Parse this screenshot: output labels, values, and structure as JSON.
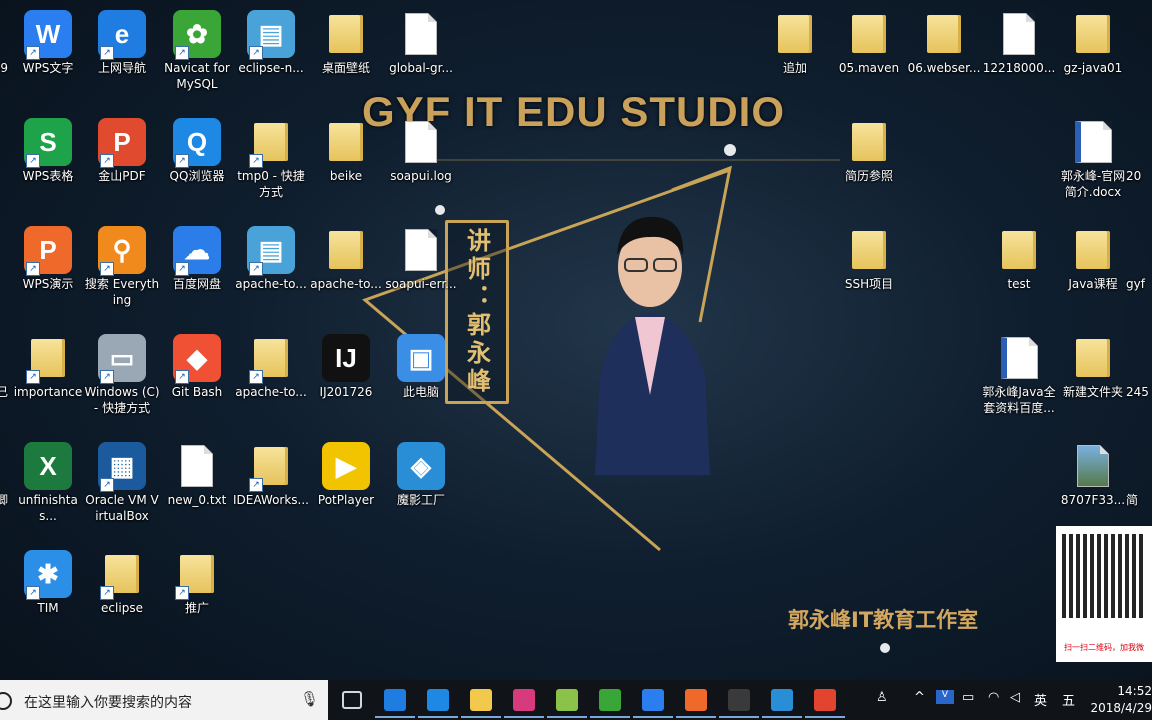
{
  "wallpaper": {
    "title": "GYF IT EDU STUDIO",
    "teacher_label": "讲师：郭永峰",
    "studio_name": "郭永峰IT教育工作室"
  },
  "left_edge_fragments": [
    "9",
    "己",
    "卿"
  ],
  "icons_left": [
    {
      "label": "WPS文字",
      "icon": "wps-writer-icon",
      "color": "#2a7ef0",
      "glyph": "W"
    },
    {
      "label": "上网导航",
      "icon": "ie-browser-icon",
      "color": "#1f7ce0",
      "glyph": "e"
    },
    {
      "label": "Navicat for MySQL",
      "icon": "navicat-icon",
      "color": "#3aa637",
      "glyph": "✿"
    },
    {
      "label": "eclipse-n...",
      "icon": "zip-archive-icon",
      "color": "#4aa3d8",
      "glyph": "▤"
    },
    {
      "label": "桌面壁纸",
      "icon": "folder-icon",
      "color": "",
      "glyph": ""
    },
    {
      "label": "global-gr...",
      "icon": "document-icon",
      "color": "",
      "glyph": ""
    },
    {
      "label": "WPS表格",
      "icon": "wps-spreadsheet-icon",
      "color": "#1fa34a",
      "glyph": "S"
    },
    {
      "label": "金山PDF",
      "icon": "pdf-icon",
      "color": "#e04a2f",
      "glyph": "P"
    },
    {
      "label": "QQ浏览器",
      "icon": "qq-browser-icon",
      "color": "#1e88e5",
      "glyph": "Q"
    },
    {
      "label": "tmp0 - 快捷方式",
      "icon": "folder-icon",
      "color": "",
      "glyph": ""
    },
    {
      "label": "beike",
      "icon": "folder-icon",
      "color": "",
      "glyph": ""
    },
    {
      "label": "soapui.log",
      "icon": "document-icon",
      "color": "",
      "glyph": ""
    },
    {
      "label": "WPS演示",
      "icon": "wps-presentation-icon",
      "color": "#ef6a2a",
      "glyph": "P"
    },
    {
      "label": "搜索 Everything",
      "icon": "everything-search-icon",
      "color": "#f08a1c",
      "glyph": "⚲"
    },
    {
      "label": "百度网盘",
      "icon": "baidu-netdisk-icon",
      "color": "#2b7de9",
      "glyph": "☁"
    },
    {
      "label": "apache-to...",
      "icon": "zip-archive-icon",
      "color": "#4aa3d8",
      "glyph": "▤"
    },
    {
      "label": "apache-to...",
      "icon": "folder-icon",
      "color": "",
      "glyph": ""
    },
    {
      "label": "soapui-err...",
      "icon": "document-icon",
      "color": "",
      "glyph": ""
    },
    {
      "label": "importance",
      "icon": "folder-icon",
      "color": "",
      "glyph": ""
    },
    {
      "label": "Windows (C) - 快捷方式",
      "icon": "drive-icon",
      "color": "#9aa7b4",
      "glyph": "▭"
    },
    {
      "label": "Git Bash",
      "icon": "git-bash-icon",
      "color": "#f05033",
      "glyph": "◆"
    },
    {
      "label": "apache-to...",
      "icon": "folder-icon",
      "color": "",
      "glyph": ""
    },
    {
      "label": "IJ201726",
      "icon": "intellij-icon",
      "color": "#111",
      "glyph": "IJ"
    },
    {
      "label": "此电脑",
      "icon": "this-pc-icon",
      "color": "#3b8ee6",
      "glyph": "▣"
    },
    {
      "label": "unfinishtas...",
      "icon": "excel-file-icon",
      "color": "#1d7a3e",
      "glyph": "X"
    },
    {
      "label": "Oracle VM VirtualBox",
      "icon": "virtualbox-icon",
      "color": "#1b5a9c",
      "glyph": "▦"
    },
    {
      "label": "new_0.txt",
      "icon": "document-icon",
      "color": "",
      "glyph": ""
    },
    {
      "label": "IDEAWorks...",
      "icon": "folder-icon",
      "color": "",
      "glyph": ""
    },
    {
      "label": "PotPlayer",
      "icon": "potplayer-icon",
      "color": "#f2c400",
      "glyph": "▶"
    },
    {
      "label": "魔影工厂",
      "icon": "format-factory-icon",
      "color": "#2a8ed6",
      "glyph": "◈"
    },
    {
      "label": "TIM",
      "icon": "tim-icon",
      "color": "#2b8fe8",
      "glyph": "✱"
    },
    {
      "label": "eclipse",
      "icon": "folder-icon",
      "color": "",
      "glyph": ""
    },
    {
      "label": "推广",
      "icon": "folder-icon",
      "color": "",
      "glyph": ""
    }
  ],
  "icons_right": [
    {
      "label": "追加",
      "icon": "folder-icon"
    },
    {
      "label": "05.maven",
      "icon": "folder-icon"
    },
    {
      "label": "06.webser...",
      "icon": "folder-icon"
    },
    {
      "label": "12218000...",
      "icon": "document-icon"
    },
    {
      "label": "gz-java01",
      "icon": "folder-icon"
    },
    {
      "label": "简历参照",
      "icon": "folder-icon"
    },
    {
      "label": "郭永峰-官网简介.docx",
      "icon": "word-file-icon"
    },
    {
      "label": "SSH项目",
      "icon": "folder-icon"
    },
    {
      "label": "test",
      "icon": "folder-icon"
    },
    {
      "label": "Java课程",
      "icon": "folder-icon"
    },
    {
      "label": "郭永峰Java全套资料百度...",
      "icon": "word-file-icon"
    },
    {
      "label": "新建文件夹",
      "icon": "folder-icon"
    },
    {
      "label": "8707F33...",
      "icon": "image-file-icon"
    }
  ],
  "right_edge_fragments": [
    "20",
    "gyf",
    "245",
    "简"
  ],
  "qr_caption": "扫一扫二维码，加我微",
  "taskbar": {
    "search_placeholder": "在这里输入你要搜索的内容",
    "apps": [
      {
        "name": "task-view-icon",
        "color": "#cfd8e3"
      },
      {
        "name": "edge-icon",
        "color": "#1f7ce0"
      },
      {
        "name": "qq-browser-icon",
        "color": "#1e88e5"
      },
      {
        "name": "file-explorer-icon",
        "color": "#f2c94c"
      },
      {
        "name": "intellij-icon",
        "color": "#d83b7d"
      },
      {
        "name": "notepad-plus-icon",
        "color": "#8bc34a"
      },
      {
        "name": "camtasia-icon",
        "color": "#3aa637"
      },
      {
        "name": "wps-writer-icon",
        "color": "#2a7ef0"
      },
      {
        "name": "wps-presentation-icon",
        "color": "#ef6a2a"
      },
      {
        "name": "cmd-icon",
        "color": "#3a3a3a"
      },
      {
        "name": "format-factory-icon",
        "color": "#2a8ed6"
      },
      {
        "name": "camtasia-recorder-icon",
        "color": "#e2442f"
      }
    ],
    "tray": {
      "ime_lang": "英",
      "ime_mode": "五",
      "time": "14:52",
      "date": "2018/4/29"
    }
  }
}
